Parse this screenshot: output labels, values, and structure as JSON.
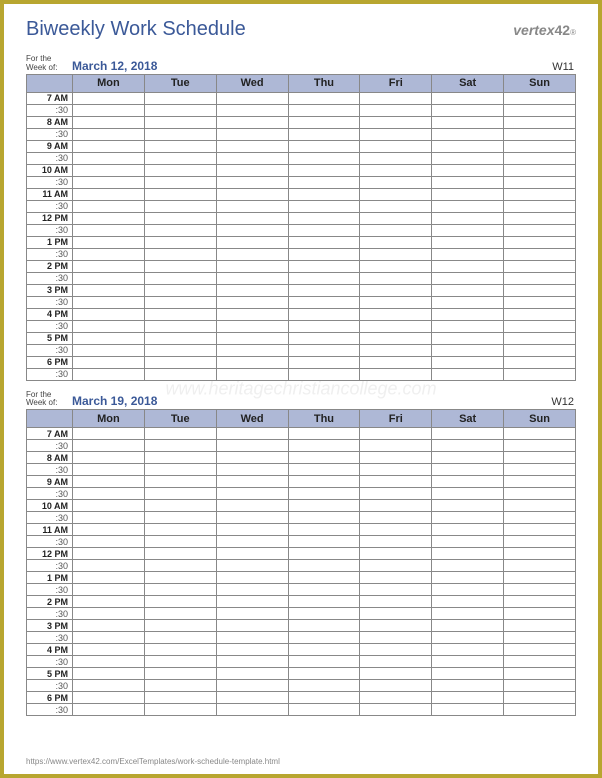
{
  "title": "Biweekly Work Schedule",
  "brand": {
    "name": "vertex",
    "num": "42",
    "reg": "®"
  },
  "for_week_label": "For the\nWeek of:",
  "days": [
    "Mon",
    "Tue",
    "Wed",
    "Thu",
    "Fri",
    "Sat",
    "Sun"
  ],
  "hours": [
    "7 AM",
    "8 AM",
    "9 AM",
    "10 AM",
    "11 AM",
    "12 PM",
    "1 PM",
    "2 PM",
    "3 PM",
    "4 PM",
    "5 PM",
    "6 PM"
  ],
  "half_label": ":30",
  "weeks": [
    {
      "date": "March 12, 2018",
      "wnum": "W11"
    },
    {
      "date": "March 19, 2018",
      "wnum": "W12"
    }
  ],
  "footer_url": "https://www.vertex42.com/ExcelTemplates/work-schedule-template.html",
  "watermark": "www.heritagechristiancollege.com"
}
